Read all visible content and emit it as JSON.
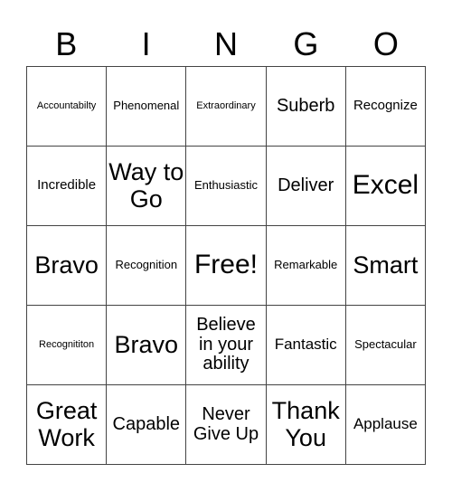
{
  "header": {
    "letters": [
      "B",
      "I",
      "N",
      "G",
      "O"
    ]
  },
  "card": {
    "cells": [
      {
        "text": "Accountabilty",
        "size": "s-xs"
      },
      {
        "text": "Phenomenal",
        "size": "s-sm"
      },
      {
        "text": "Extraordinary",
        "size": "s-xs"
      },
      {
        "text": "Suberb",
        "size": "s-xl"
      },
      {
        "text": "Recognize",
        "size": "s-md"
      },
      {
        "text": "Incredible",
        "size": "s-md"
      },
      {
        "text": "Way to Go",
        "size": "s-xxl"
      },
      {
        "text": "Enthusiastic",
        "size": "s-sm"
      },
      {
        "text": "Deliver",
        "size": "s-xl"
      },
      {
        "text": "Excel",
        "size": "s-xxxl"
      },
      {
        "text": "Bravo",
        "size": "s-xxl"
      },
      {
        "text": "Recognition",
        "size": "s-sm"
      },
      {
        "text": "Free!",
        "size": "s-xxxl"
      },
      {
        "text": "Remarkable",
        "size": "s-sm"
      },
      {
        "text": "Smart",
        "size": "s-xxl"
      },
      {
        "text": "Recognititon",
        "size": "s-xs"
      },
      {
        "text": "Bravo",
        "size": "s-xxl"
      },
      {
        "text": "Believe in your ability",
        "size": "s-xl"
      },
      {
        "text": "Fantastic",
        "size": "s-lg"
      },
      {
        "text": "Spectacular",
        "size": "s-sm"
      },
      {
        "text": "Great Work",
        "size": "s-xxl"
      },
      {
        "text": "Capable",
        "size": "s-xl"
      },
      {
        "text": "Never Give Up",
        "size": "s-xl"
      },
      {
        "text": "Thank You",
        "size": "s-xxl"
      },
      {
        "text": "Applause",
        "size": "s-lg"
      }
    ]
  }
}
